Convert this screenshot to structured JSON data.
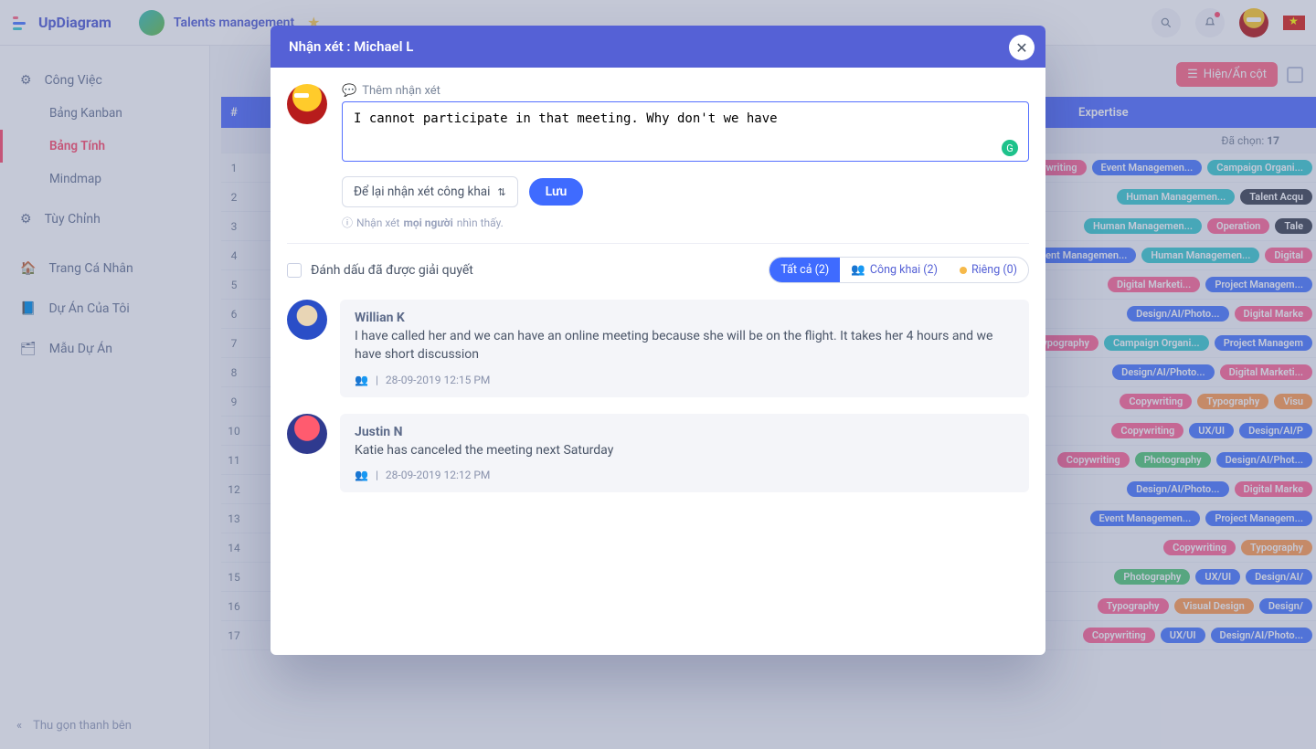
{
  "brand": "UpDiagram",
  "workspace": {
    "name": "Talents management",
    "tab": "Talents manag…"
  },
  "topbar": {
    "search_aria": "Search",
    "notif_aria": "Notifications"
  },
  "sidebar": {
    "work": "Công Việc",
    "kanban": "Bảng Kanban",
    "sheet": "Bảng Tính",
    "mindmap": "Mindmap",
    "customize": "Tùy Chỉnh",
    "profile": "Trang Cá Nhân",
    "myprojects": "Dự Án Của Tôi",
    "templates": "Mẫu Dự Án",
    "collapse": "Thu gọn thanh bên"
  },
  "table": {
    "hide_col": "Hiện/Ẩn cột",
    "num_header": "#",
    "expertise_header": "Expertise",
    "selected_prefix": "Đã chọn:",
    "selected_count": "17",
    "rows": [
      {
        "n": "1",
        "chips": [
          {
            "t": "Copywriting",
            "c": "c-pink"
          },
          {
            "t": "Event Managemen...",
            "c": "c-blue"
          },
          {
            "t": "Campaign Organi...",
            "c": "c-teal"
          }
        ]
      },
      {
        "n": "2",
        "chips": [
          {
            "t": "Human Managemen...",
            "c": "c-teal"
          },
          {
            "t": "Talent Acqu",
            "c": "c-gray"
          }
        ]
      },
      {
        "n": "3",
        "chips": [
          {
            "t": "Human Managemen...",
            "c": "c-teal"
          },
          {
            "t": "Operation",
            "c": "c-pink"
          },
          {
            "t": "Tale",
            "c": "c-gray"
          }
        ]
      },
      {
        "n": "4",
        "chips": [
          {
            "t": "Event Managemen...",
            "c": "c-blue"
          },
          {
            "t": "Human Managemen...",
            "c": "c-teal"
          },
          {
            "t": "Digital",
            "c": "c-pink"
          }
        ]
      },
      {
        "n": "5",
        "chips": [
          {
            "t": "Digital Marketi...",
            "c": "c-pink"
          },
          {
            "t": "Project Managem...",
            "c": "c-blue"
          }
        ]
      },
      {
        "n": "6",
        "chips": [
          {
            "t": "Design/AI/Photo...",
            "c": "c-blue"
          },
          {
            "t": "Digital Marke",
            "c": "c-pink"
          }
        ]
      },
      {
        "n": "7",
        "chips": [
          {
            "t": "Typography",
            "c": "c-pink"
          },
          {
            "t": "Campaign Organi...",
            "c": "c-teal"
          },
          {
            "t": "Project Managem",
            "c": "c-blue"
          }
        ]
      },
      {
        "n": "8",
        "chips": [
          {
            "t": "Design/AI/Photo...",
            "c": "c-blue"
          },
          {
            "t": "Digital Marketi...",
            "c": "c-pink"
          }
        ]
      },
      {
        "n": "9",
        "chips": [
          {
            "t": "Copywriting",
            "c": "c-pink"
          },
          {
            "t": "Typography",
            "c": "c-orange"
          },
          {
            "t": "Visu",
            "c": "c-orange"
          }
        ]
      },
      {
        "n": "10",
        "chips": [
          {
            "t": "Copywriting",
            "c": "c-pink"
          },
          {
            "t": "UX/UI",
            "c": "c-blue"
          },
          {
            "t": "Design/AI/P",
            "c": "c-blue"
          }
        ]
      },
      {
        "n": "11",
        "chips": [
          {
            "t": "Copywriting",
            "c": "c-pink"
          },
          {
            "t": "Photography",
            "c": "c-green"
          },
          {
            "t": "Design/AI/Phot...",
            "c": "c-blue"
          }
        ]
      },
      {
        "n": "12",
        "chips": [
          {
            "t": "Design/AI/Photo...",
            "c": "c-blue"
          },
          {
            "t": "Digital Marke",
            "c": "c-pink"
          }
        ]
      },
      {
        "n": "13",
        "chips": [
          {
            "t": "Event Managemen...",
            "c": "c-blue"
          },
          {
            "t": "Project Managem...",
            "c": "c-blue"
          }
        ]
      },
      {
        "n": "14",
        "chips": [
          {
            "t": "Copywriting",
            "c": "c-pink"
          },
          {
            "t": "Typography",
            "c": "c-orange"
          }
        ]
      },
      {
        "n": "15",
        "chips": [
          {
            "t": "Photography",
            "c": "c-green"
          },
          {
            "t": "UX/UI",
            "c": "c-blue"
          },
          {
            "t": "Design/AI/",
            "c": "c-blue"
          }
        ]
      },
      {
        "n": "16",
        "chips": [
          {
            "t": "Typography",
            "c": "c-pink"
          },
          {
            "t": "Visual Design",
            "c": "c-orange"
          },
          {
            "t": "Design/",
            "c": "c-blue"
          }
        ]
      },
      {
        "n": "17",
        "chips": [
          {
            "t": "Copywriting",
            "c": "c-pink"
          },
          {
            "t": "UX/UI",
            "c": "c-blue"
          },
          {
            "t": "Design/AI/Photo...",
            "c": "c-blue"
          }
        ]
      }
    ]
  },
  "modal": {
    "title": "Nhận xét : Michael L",
    "add_label": "Thêm nhận xét",
    "draft": "I cannot participate in that meeting. Why don't we have ",
    "visibility": "Để lại nhận xét công khai",
    "save": "Lưu",
    "hint_pre": "Nhận xét",
    "hint_bold": "mọi người",
    "hint_post": "nhìn thấy.",
    "resolved": "Đánh dấu đã được giải quyết",
    "tab_all": "Tất cả (2)",
    "tab_public": "Công khai (2)",
    "tab_private": "Riêng (0)",
    "comments": [
      {
        "author": "Willian K",
        "text": "I have called her and we can have an online meeting because she will be on the flight. It takes her 4 hours and we have short discussion",
        "ts": "28-09-2019 12:15 PM"
      },
      {
        "author": "Justin N",
        "text": "Katie has canceled the meeting next Saturday",
        "ts": "28-09-2019 12:12 PM"
      }
    ]
  }
}
